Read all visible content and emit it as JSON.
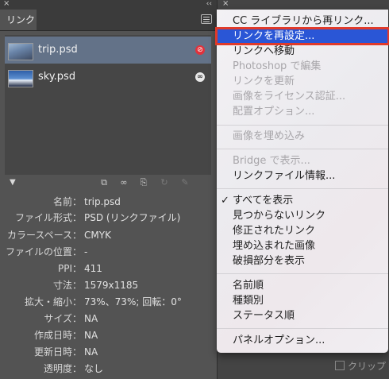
{
  "links_panel": {
    "close_glyph": "×",
    "collapse_glyph": "‹‹",
    "tab_label": "リンク",
    "files": [
      {
        "name": "trip.psd",
        "status_icon": "missing-link-icon",
        "selected": true
      },
      {
        "name": "sky.psd",
        "status_icon": "link-icon",
        "selected": false
      }
    ],
    "info": [
      {
        "label": "名前：",
        "value": "trip.psd"
      },
      {
        "label": "ファイル形式：",
        "value": "PSD (リンクファイル)"
      },
      {
        "label": "カラースペース：",
        "value": "CMYK"
      },
      {
        "label": "ファイルの位置：",
        "value": "-"
      },
      {
        "label": "PPI：",
        "value": "411"
      },
      {
        "label": "寸法：",
        "value": "1579x1185"
      },
      {
        "label": "拡大・縮小：",
        "value": "73%、73%; 回転：0°"
      },
      {
        "label": "サイズ：",
        "value": "NA"
      },
      {
        "label": "作成日時：",
        "value": "NA"
      },
      {
        "label": "更新日時：",
        "value": "NA"
      },
      {
        "label": "透明度：",
        "value": "なし"
      }
    ]
  },
  "right_panel": {
    "close_glyph": "×",
    "clip_label": "クリップ"
  },
  "menu": {
    "items": [
      {
        "label": "CC ライブラリから再リンク...",
        "enabled": true
      },
      {
        "label": "リンクを再設定...",
        "enabled": true,
        "highlighted": true
      },
      {
        "label": "リンクへ移動",
        "enabled": true
      },
      {
        "label": "Photoshop で編集",
        "enabled": false
      },
      {
        "label": "リンクを更新",
        "enabled": false
      },
      {
        "label": "画像をライセンス認証...",
        "enabled": false
      },
      {
        "label": "配置オプション...",
        "enabled": false
      },
      {
        "label": "画像を埋め込み",
        "enabled": false
      },
      {
        "label": "Bridge で表示...",
        "enabled": false
      },
      {
        "label": "リンクファイル情報...",
        "enabled": true
      },
      {
        "label": "すべてを表示",
        "enabled": true,
        "checked": true
      },
      {
        "label": "見つからないリンク",
        "enabled": true
      },
      {
        "label": "修正されたリンク",
        "enabled": true
      },
      {
        "label": "埋め込まれた画像",
        "enabled": true
      },
      {
        "label": "破損部分を表示",
        "enabled": true
      },
      {
        "label": "名前順",
        "enabled": true
      },
      {
        "label": "種類別",
        "enabled": true
      },
      {
        "label": "ステータス順",
        "enabled": true
      },
      {
        "label": "パネルオプション...",
        "enabled": true
      }
    ],
    "check_glyph": "✓"
  }
}
